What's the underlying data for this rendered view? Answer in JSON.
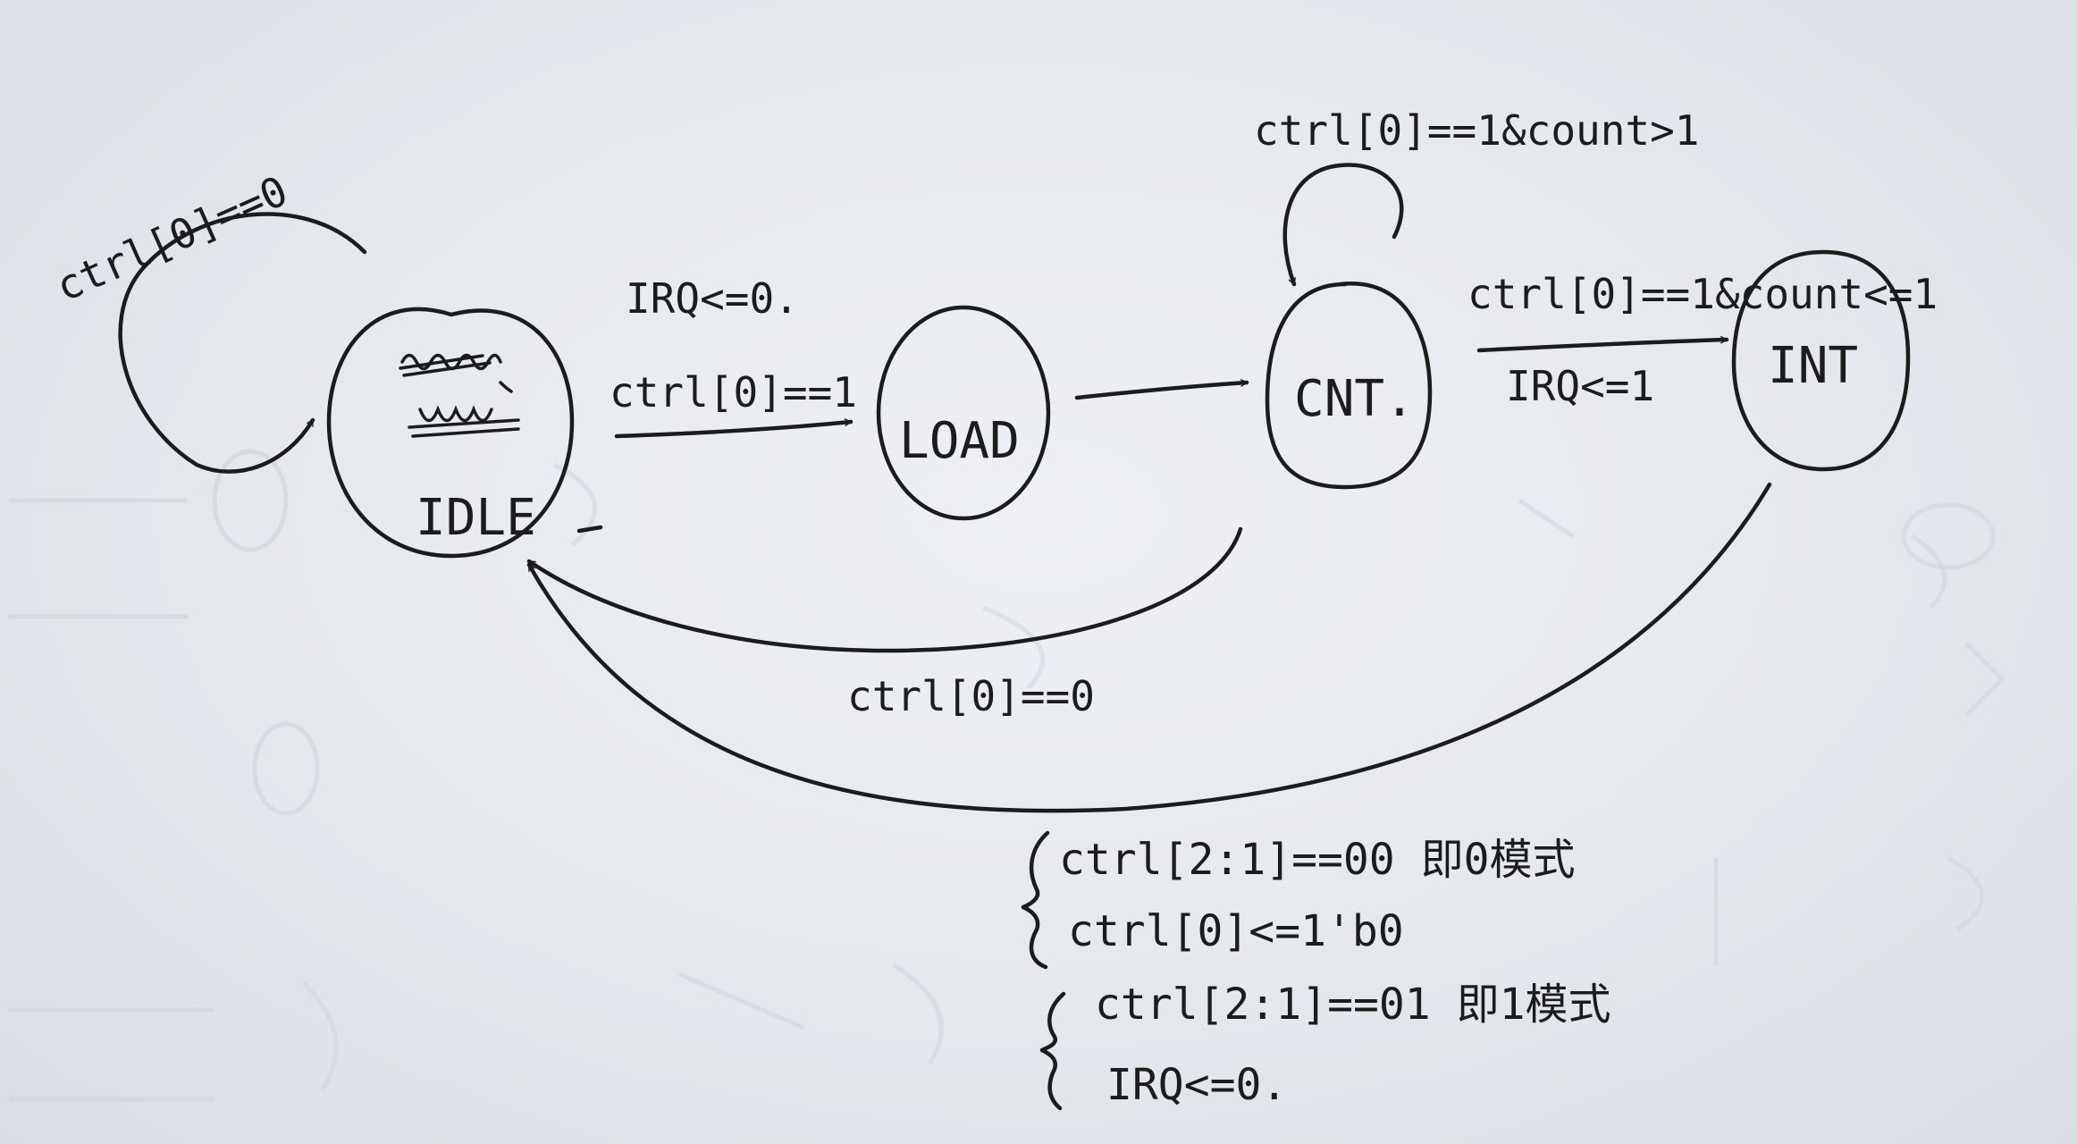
{
  "states": {
    "idle": {
      "label": "IDLE"
    },
    "load": {
      "label": "LOAD"
    },
    "cnt": {
      "label": "CNT."
    },
    "int": {
      "label": "INT"
    }
  },
  "transitions": {
    "idle_self": "ctrl[0]==0",
    "idle_to_load_output": "IRQ<=0.",
    "idle_to_load_condition": "ctrl[0]==1",
    "cnt_self": "ctrl[0]==1&count>1",
    "cnt_to_int_condition": "ctrl[0]==1&count<=1",
    "cnt_to_int_output": "IRQ<=1",
    "cnt_to_idle": "ctrl[0]==0"
  },
  "notes": {
    "mode0_condition": "ctrl[2:1]==00 即0模式",
    "mode0_action": "ctrl[0]<=1'b0",
    "mode1_condition": "ctrl[2:1]==01 即1模式",
    "mode1_action": "IRQ<=0."
  },
  "colors": {
    "ink": "#1c1c1c",
    "paper": "#e9ebef"
  }
}
